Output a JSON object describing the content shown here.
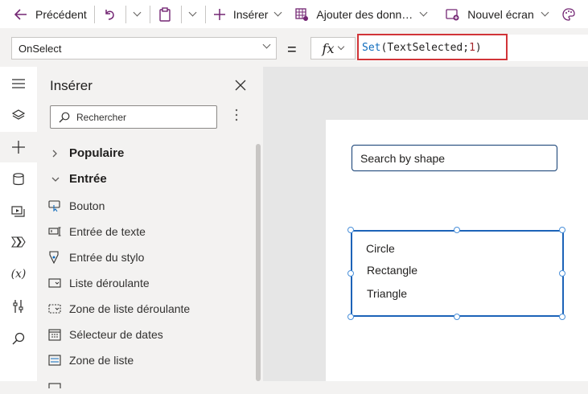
{
  "toolbar": {
    "back_label": "Précédent",
    "insert_label": "Insérer",
    "add_data_label": "Ajouter des donn…",
    "new_screen_label": "Nouvel écran"
  },
  "formula_bar": {
    "property": "OnSelect",
    "equals": "=",
    "fx_label": "fx",
    "formula": {
      "fn": "Set",
      "open": "(",
      "arg": "TextSelected",
      "sep": ";",
      "num": "1",
      "close": ")"
    }
  },
  "insert_panel": {
    "title": "Insérer",
    "search_placeholder": "Rechercher",
    "categories": [
      {
        "label": "Populaire",
        "expanded": false
      },
      {
        "label": "Entrée",
        "expanded": true
      }
    ],
    "items": [
      {
        "label": "Bouton",
        "icon": "button-icon"
      },
      {
        "label": "Entrée de texte",
        "icon": "text-input-icon"
      },
      {
        "label": "Entrée du stylo",
        "icon": "pen-icon"
      },
      {
        "label": "Liste déroulante",
        "icon": "dropdown-icon"
      },
      {
        "label": "Zone de liste déroulante",
        "icon": "combobox-icon"
      },
      {
        "label": "Sélecteur de dates",
        "icon": "calendar-icon"
      },
      {
        "label": "Zone de liste",
        "icon": "listbox-icon"
      }
    ]
  },
  "canvas": {
    "search_input_value": "Search by shape",
    "list_items": [
      "Circle",
      "Rectangle",
      "Triangle"
    ]
  },
  "colors": {
    "accent": "#1c63b8",
    "highlight_border": "#d13438",
    "formula_fn": "#0f6cbd"
  }
}
